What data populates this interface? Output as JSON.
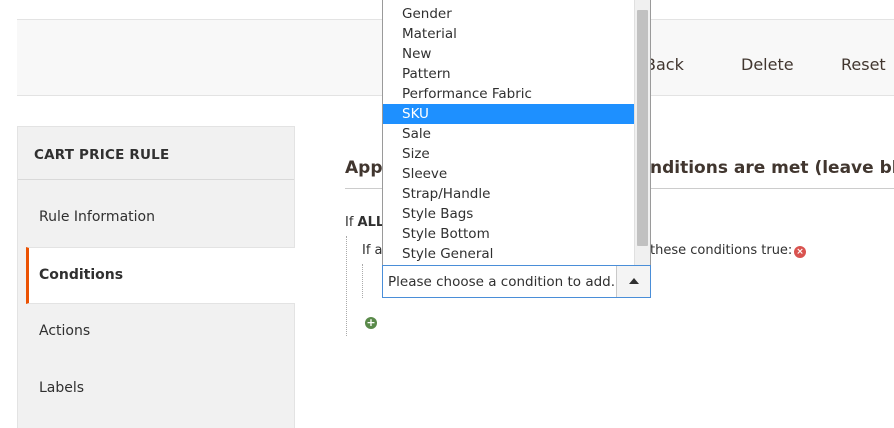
{
  "toolbar": {
    "back_label": "Back",
    "delete_label": "Delete",
    "reset_label": "Reset"
  },
  "sidebar": {
    "title": "CART PRICE RULE",
    "items": [
      {
        "label": "Rule Information"
      },
      {
        "label": "Conditions"
      },
      {
        "label": "Actions"
      },
      {
        "label": "Labels"
      }
    ]
  },
  "main": {
    "heading_left": "Appl",
    "heading_right": "nditions are met (leave blank f",
    "if_prefix": "If ",
    "if_all": "ALL",
    "sub_left": "If a",
    "sub_right": "these conditions true:"
  },
  "select": {
    "value": "Please choose a condition to add."
  },
  "dropdown": {
    "options": [
      "Gender",
      "Material",
      "New",
      "Pattern",
      "Performance Fabric",
      "SKU",
      "Sale",
      "Size",
      "Sleeve",
      "Strap/Handle",
      "Style Bags",
      "Style Bottom",
      "Style General"
    ],
    "selected": "SKU"
  },
  "colors": {
    "accent": "#eb5202",
    "selection": "#1e90ff",
    "remove": "#d9534f",
    "add": "#5a8a4a"
  }
}
